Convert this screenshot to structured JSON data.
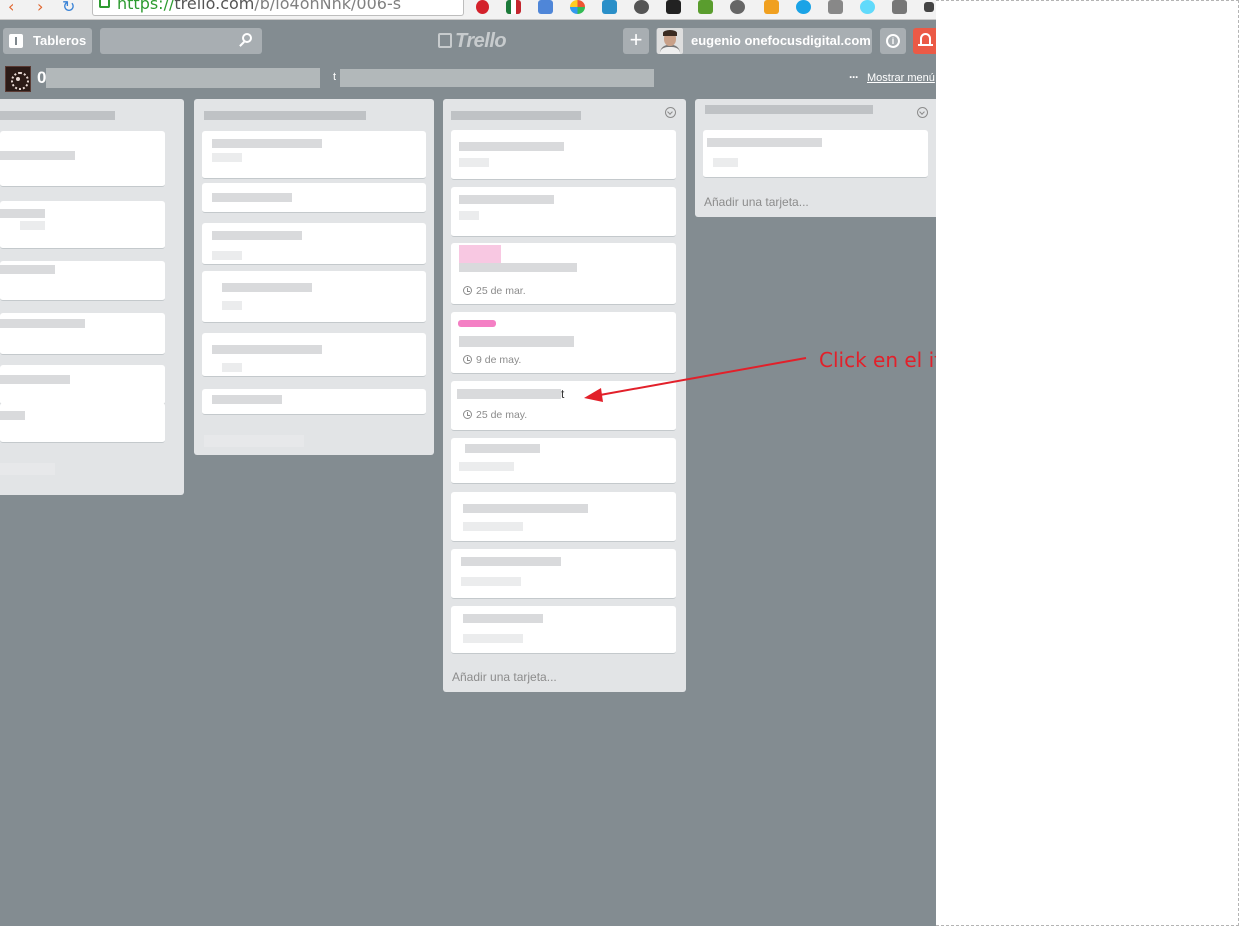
{
  "browser": {
    "url_protocol": "https://",
    "url_host": "trello.com",
    "url_path": "/b/lo4onNnk/006-s"
  },
  "header": {
    "boards_label": "Tableros",
    "logo_text": "Trello",
    "add_label": "+",
    "member_name": "eugenio onefocusdigital.com",
    "info_label": "i"
  },
  "board": {
    "title_visible": "0",
    "team_visible": "t",
    "menu_dots": "···",
    "show_menu_label": "Mostrar menú"
  },
  "lists": {
    "col3": {
      "cards": {
        "c3": {
          "due": "25 de mar."
        },
        "c4": {
          "due": "9 de may."
        },
        "c5": {
          "title_tail": "t",
          "due": "25 de may."
        }
      },
      "add_card": "Añadir una tarjeta..."
    },
    "col4": {
      "add_card": "Añadir una tarjeta..."
    }
  },
  "annotation": {
    "text": "Click en el item",
    "color": "#e2202a"
  },
  "colors": {
    "board_background": "#838c91",
    "list_background": "#e2e4e6",
    "label_pink": "#f47fc4",
    "notification_red": "#eb5a46"
  }
}
